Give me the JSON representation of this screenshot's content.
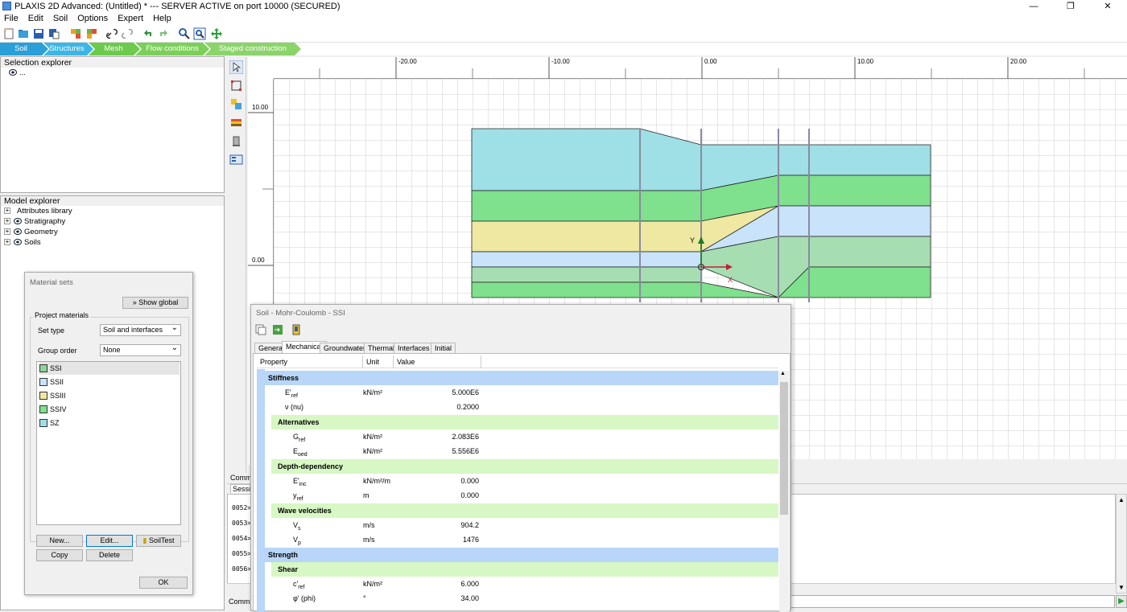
{
  "window": {
    "title": "PLAXIS 2D Advanced: (Untitled) * --- SERVER ACTIVE on port 10000 (SECURED)",
    "min_glyph": "—",
    "max_glyph": "❐",
    "close_glyph": "✕"
  },
  "menu": [
    "File",
    "Edit",
    "Soil",
    "Options",
    "Expert",
    "Help"
  ],
  "phases": [
    "Soil",
    "Structures",
    "Mesh",
    "Flow conditions",
    "Staged construction"
  ],
  "selection_explorer": {
    "title": "Selection explorer",
    "root": "..."
  },
  "model_explorer": {
    "title": "Model explorer",
    "items": [
      "Attributes library",
      "Stratigraphy",
      "Geometry",
      "Soils"
    ]
  },
  "ruler": {
    "x_labels": [
      "-20.00",
      "-10.00",
      "0.00",
      "10.00",
      "20.00"
    ],
    "y_labels": [
      "10.00",
      "0.00"
    ]
  },
  "axes": {
    "x": "X",
    "y": "Y"
  },
  "material_sets": {
    "title": "Material sets",
    "show_global": "Show global",
    "section": "Project materials",
    "set_type_label": "Set type",
    "set_type_value": "Soil and interfaces",
    "group_order_label": "Group order",
    "group_order_value": "None",
    "items": [
      {
        "name": "SSI",
        "color": "#8ed39a"
      },
      {
        "name": "SSII",
        "color": "#c8e3fa"
      },
      {
        "name": "SSIII",
        "color": "#eee8a2"
      },
      {
        "name": "SSIV",
        "color": "#7fe08d"
      },
      {
        "name": "SZ",
        "color": "#9ee0e6"
      }
    ],
    "buttons": {
      "new": "New...",
      "edit": "Edit...",
      "soiltest": "SoilTest",
      "copy": "Copy",
      "delete": "Delete",
      "ok": "OK"
    }
  },
  "soil_window": {
    "title": "Soil - Mohr-Coulomb - SSI",
    "tabs": [
      "General",
      "Mechanical",
      "Groundwater",
      "Thermal",
      "Interfaces",
      "Initial"
    ],
    "headers": {
      "property": "Property",
      "unit": "Unit",
      "value": "Value"
    },
    "rows": {
      "stiffness": "Stiffness",
      "eref": {
        "name": "E'",
        "sub": "ref",
        "unit": "kN/m²",
        "value": "5.000E6"
      },
      "nu": {
        "name": "ν (nu)",
        "unit": "",
        "value": "0.2000"
      },
      "alternatives": "Alternatives",
      "gref": {
        "name": "G",
        "sub": "ref",
        "unit": "kN/m²",
        "value": "2.083E6"
      },
      "eoed": {
        "name": "E",
        "sub": "oed",
        "unit": "kN/m²",
        "value": "5.556E6"
      },
      "depth": "Depth-dependency",
      "einc": {
        "name": "E'",
        "sub": "inc",
        "unit": "kN/m²/m",
        "value": "0.000"
      },
      "yref": {
        "name": "y",
        "sub": "ref",
        "unit": "m",
        "value": "0.000"
      },
      "wave": "Wave velocities",
      "vs": {
        "name": "V",
        "sub": "s",
        "unit": "m/s",
        "value": "904.2"
      },
      "vp": {
        "name": "V",
        "sub": "p",
        "unit": "m/s",
        "value": "1476"
      },
      "strength": "Strength",
      "shear": "Shear",
      "cref": {
        "name": "c'",
        "sub": "ref",
        "unit": "kN/m²",
        "value": "6.000"
      },
      "phi": {
        "name": "φ' (phi)",
        "unit": "°",
        "value": "34.00"
      }
    }
  },
  "commands": {
    "title": "Comma",
    "session": "Session",
    "lines": [
      "0052>",
      "0053>",
      "0054>",
      "0055>",
      "0056>"
    ],
    "input_label": "Comman"
  }
}
